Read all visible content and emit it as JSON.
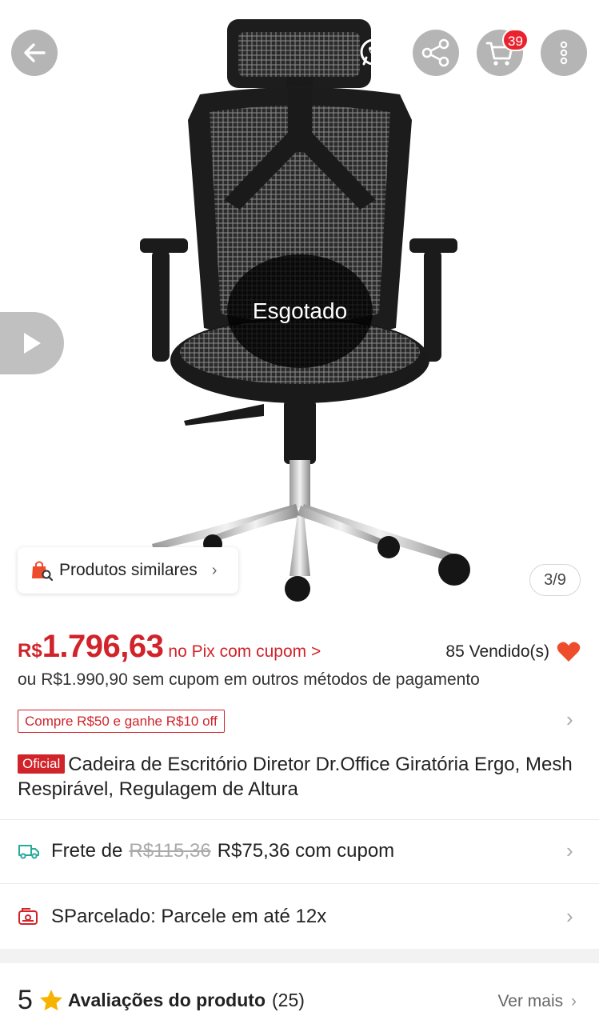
{
  "header": {
    "back_icon": "arrow-left-icon",
    "whatsapp_icon": "whatsapp-icon",
    "share_icon": "share-icon",
    "cart_icon": "cart-icon",
    "cart_count": "39",
    "more_icon": "more-vertical-icon"
  },
  "gallery": {
    "status_overlay": "Esgotado",
    "image_counter": "3/9",
    "similar_label": "Produtos similares",
    "play_icon": "play-icon"
  },
  "price": {
    "currency": "R$",
    "value": "1.796,63",
    "pix_text": "no Pix com cupom >",
    "sold_text": "85 Vendido(s)",
    "alt_text": "ou R$1.990,90 sem cupom em outros métodos de pagamento",
    "coupon_text": "Compre R$50 e ganhe R$10 off"
  },
  "product": {
    "badge": "Oficial",
    "title": "Cadeira de Escritório Diretor Dr.Office Giratória Ergo, Mesh Respirável, Regulagem de Altura"
  },
  "shipping": {
    "prefix": "Frete de",
    "old_price": "R$115,36",
    "new_text": "R$75,36 com cupom"
  },
  "installments": {
    "text": "SParcelado: Parcele em até 12x"
  },
  "reviews": {
    "rating": "5",
    "label": "Avaliações do produto",
    "count": "(25)",
    "see_more": "Ver mais"
  },
  "colors": {
    "accent_red": "#d1232a",
    "badge_red": "#e8232f",
    "heart": "#ee4d2d",
    "star": "#f6b400",
    "truck_teal": "#26aa99"
  }
}
